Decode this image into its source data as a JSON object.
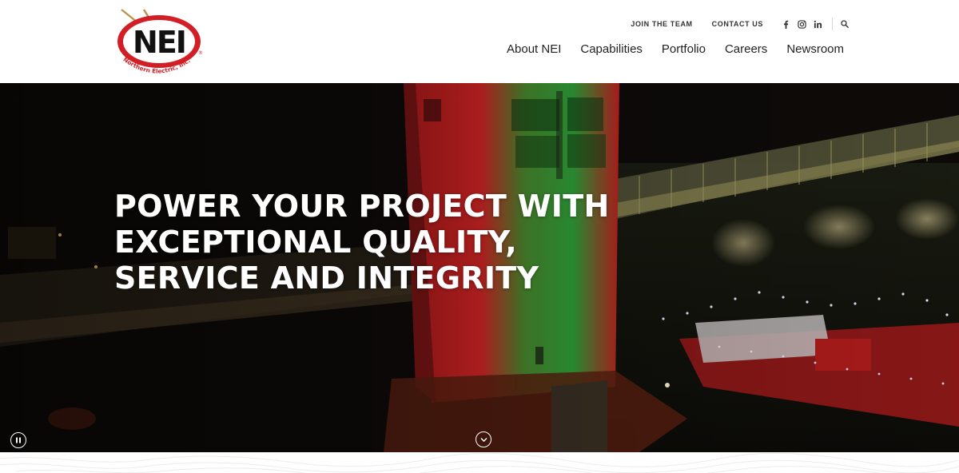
{
  "brand": {
    "logo_text": "NEI",
    "logo_subtext": "Northern Electric, Inc.",
    "logo_registered": "®",
    "colors": {
      "red": "#d21f26",
      "black": "#111111",
      "gold": "#b8954a"
    }
  },
  "utility_nav": {
    "join": "JOIN THE TEAM",
    "contact": "CONTACT US",
    "social": [
      {
        "name": "facebook",
        "glyph": "f"
      },
      {
        "name": "instagram",
        "glyph": "instagram"
      },
      {
        "name": "linkedin",
        "glyph": "in"
      }
    ],
    "search_icon": "search-icon"
  },
  "main_nav": [
    "About NEI",
    "Capabilities",
    "Portfolio",
    "Careers",
    "Newsroom"
  ],
  "hero": {
    "heading_lines": [
      "POWER YOUR PROJECT WITH",
      "EXCEPTIONAL QUALITY,",
      "SERVICE AND INTEGRITY"
    ],
    "pause_icon": "pause-icon",
    "scroll_icon": "chevron-down-icon"
  }
}
